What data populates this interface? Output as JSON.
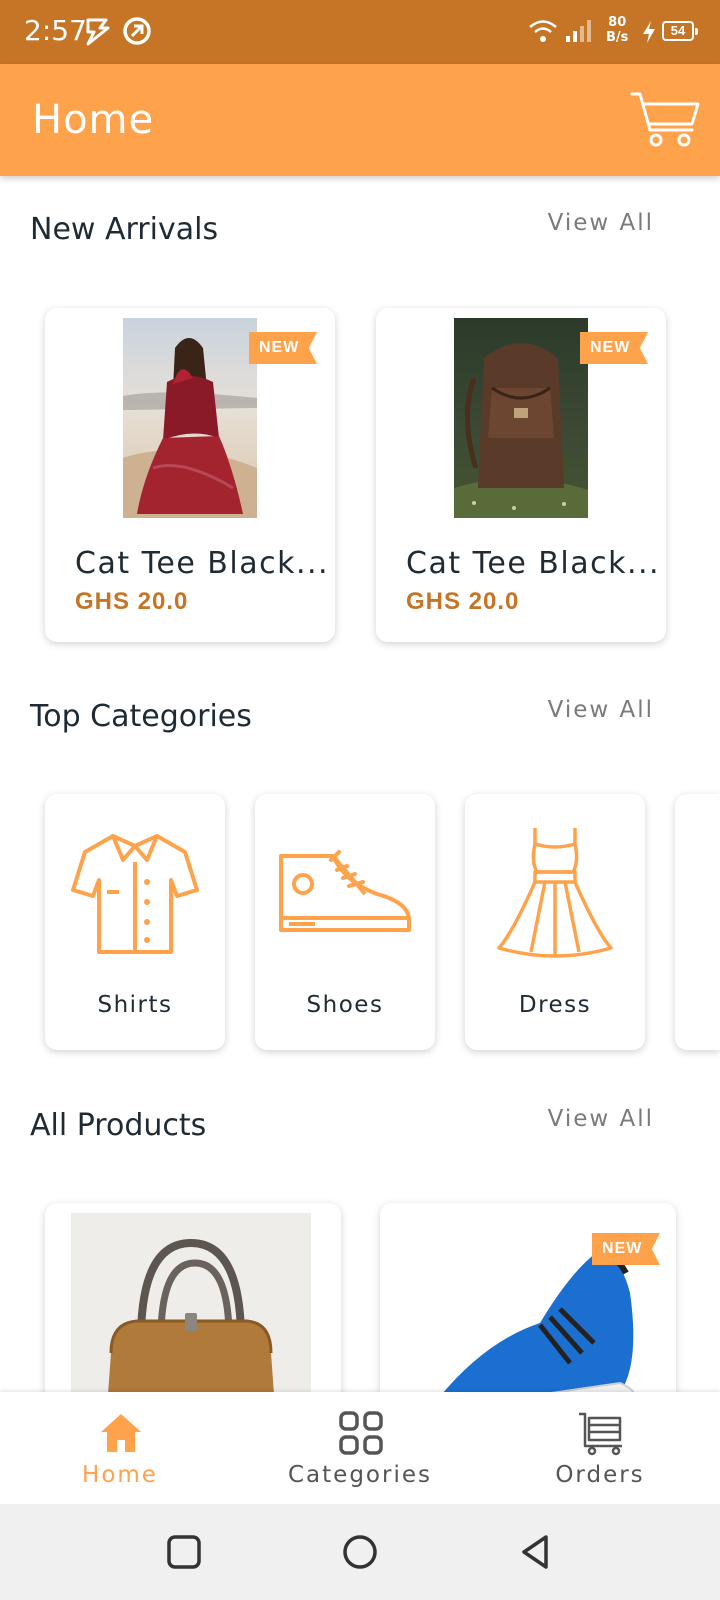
{
  "status_bar": {
    "time": "2:57",
    "net_speed_value": "80",
    "net_speed_unit": "B/s",
    "battery": "54"
  },
  "app_bar": {
    "title": "Home",
    "cart_icon": "cart-icon"
  },
  "new_arrivals": {
    "title": "New Arrivals",
    "view_all": "View All",
    "products": [
      {
        "name": "Cat Tee Black...",
        "price": "GHS 20.0",
        "badge": "NEW",
        "image": "red-dress-photo"
      },
      {
        "name": "Cat Tee Black...",
        "price": "GHS 20.0",
        "badge": "NEW",
        "image": "leather-backpack-photo"
      }
    ]
  },
  "top_categories": {
    "title": "Top Categories",
    "view_all": "View All",
    "items": [
      {
        "label": "Shirts",
        "icon": "shirt-icon"
      },
      {
        "label": "Shoes",
        "icon": "shoe-icon"
      },
      {
        "label": "Dress",
        "icon": "dress-icon"
      }
    ]
  },
  "all_products": {
    "title": "All Products",
    "view_all": "View All",
    "products": [
      {
        "image": "handbag-photo"
      },
      {
        "image": "blue-sneakers-photo",
        "badge": "NEW"
      }
    ]
  },
  "bottom_nav": {
    "items": [
      {
        "label": "Home",
        "icon": "home-icon",
        "active": true
      },
      {
        "label": "Categories",
        "icon": "categories-icon",
        "active": false
      },
      {
        "label": "Orders",
        "icon": "orders-cart-icon",
        "active": false
      }
    ]
  },
  "colors": {
    "accent": "#ffa24c",
    "status_bar": "#c57525",
    "price": "#c57525"
  }
}
